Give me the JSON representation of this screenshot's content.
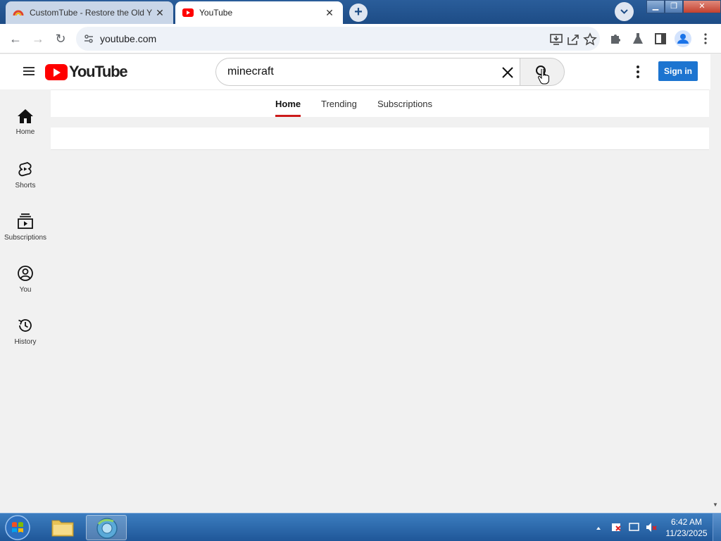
{
  "browser": {
    "tabs": [
      {
        "title": "CustomTube - Restore the Old Y",
        "active": false
      },
      {
        "title": "YouTube",
        "active": true
      }
    ],
    "new_tab_label": "+",
    "url": "youtube.com"
  },
  "youtube": {
    "logo_text": "YouTube",
    "search": {
      "value": "minecraft",
      "placeholder": "Search"
    },
    "signin_label": "Sign in",
    "tabs": [
      {
        "label": "Home",
        "selected": true
      },
      {
        "label": "Trending",
        "selected": false
      },
      {
        "label": "Subscriptions",
        "selected": false
      }
    ],
    "guide": [
      {
        "label": "Home",
        "icon": "home-icon"
      },
      {
        "label": "Shorts",
        "icon": "shorts-icon"
      },
      {
        "label": "Subscriptions",
        "icon": "subscriptions-icon"
      },
      {
        "label": "You",
        "icon": "you-icon"
      },
      {
        "label": "History",
        "icon": "history-icon"
      }
    ]
  },
  "taskbar": {
    "time": "6:42 AM",
    "date": "11/23/2025"
  },
  "colors": {
    "brand_red": "#ff0000",
    "signin_blue": "#1c74d0",
    "titlebar_blue": "#1d4c86"
  }
}
